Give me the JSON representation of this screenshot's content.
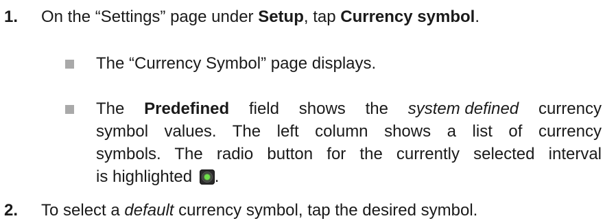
{
  "steps": [
    {
      "number": "1.",
      "text_a": "On the “Settings” page under ",
      "bold_a": "Setup",
      "text_b": ", tap ",
      "bold_b": "Currency symbol",
      "text_c": "."
    },
    {
      "number": "2.",
      "text_a": "To select a ",
      "italic_a": "default",
      "text_b": " currency symbol, tap the desired symbol."
    }
  ],
  "bullets": [
    {
      "text": "The “Currency Symbol” page displays."
    },
    {
      "line1": {
        "w1": "The",
        "bold": "Predefined",
        "w3": "field",
        "w4": "shows",
        "w5": "the",
        "italic": "system defined",
        "w7": "currency"
      },
      "line2": "symbol values. The left column shows a list of currency",
      "line3": "symbols. The radio button for the currently selected interval",
      "line4_text": "is highlighted",
      "line4_tail": ".",
      "icon": "radio-selected-icon",
      "icon_colors": {
        "frame": "#2b2b2b",
        "dot": "#6fe04a"
      }
    }
  ],
  "colors": {
    "text": "#1a1a1a",
    "bullet": "#a9a9a9"
  }
}
